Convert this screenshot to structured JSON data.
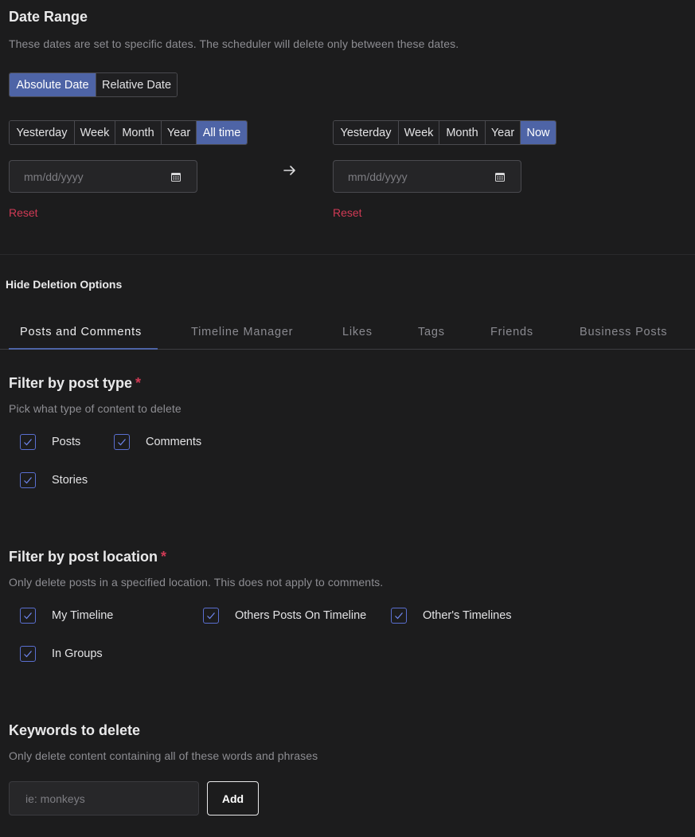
{
  "date_range": {
    "title": "Date Range",
    "description": "These dates are set to specific dates. The scheduler will delete only between these dates.",
    "mode_options": [
      "Absolute Date",
      "Relative Date"
    ],
    "mode_selected": "Absolute Date",
    "start": {
      "presets": [
        "Yesterday",
        "Week",
        "Month",
        "Year",
        "All time"
      ],
      "selected": "All time",
      "placeholder": "mm/dd/yyyy",
      "reset_label": "Reset"
    },
    "end": {
      "presets": [
        "Yesterday",
        "Week",
        "Month",
        "Year",
        "Now"
      ],
      "selected": "Now",
      "placeholder": "mm/dd/yyyy",
      "reset_label": "Reset"
    }
  },
  "deletion_options": {
    "toggle_label": "Hide Deletion Options",
    "tabs": [
      "Posts and Comments",
      "Timeline Manager",
      "Likes",
      "Tags",
      "Friends",
      "Business Posts"
    ],
    "active_tab": "Posts and Comments"
  },
  "post_type": {
    "title": "Filter by post type",
    "required_mark": "*",
    "description": "Pick what type of content to delete",
    "options": [
      {
        "label": "Posts",
        "checked": true
      },
      {
        "label": "Comments",
        "checked": true
      },
      {
        "label": "Stories",
        "checked": true
      }
    ]
  },
  "post_location": {
    "title": "Filter by post location",
    "required_mark": "*",
    "description": "Only delete posts in a specified location. This does not apply to comments.",
    "options": [
      {
        "label": "My Timeline",
        "checked": true
      },
      {
        "label": "Others Posts On Timeline",
        "checked": true
      },
      {
        "label": "Other's Timelines",
        "checked": true
      },
      {
        "label": "In Groups",
        "checked": true
      }
    ]
  },
  "keywords": {
    "title": "Keywords to delete",
    "description": "Only delete content containing all of these words and phrases",
    "placeholder": "ie: monkeys",
    "add_label": "Add"
  },
  "colors": {
    "accent": "#4e64a6",
    "danger": "#d03a55",
    "background": "#1c1c1d"
  }
}
